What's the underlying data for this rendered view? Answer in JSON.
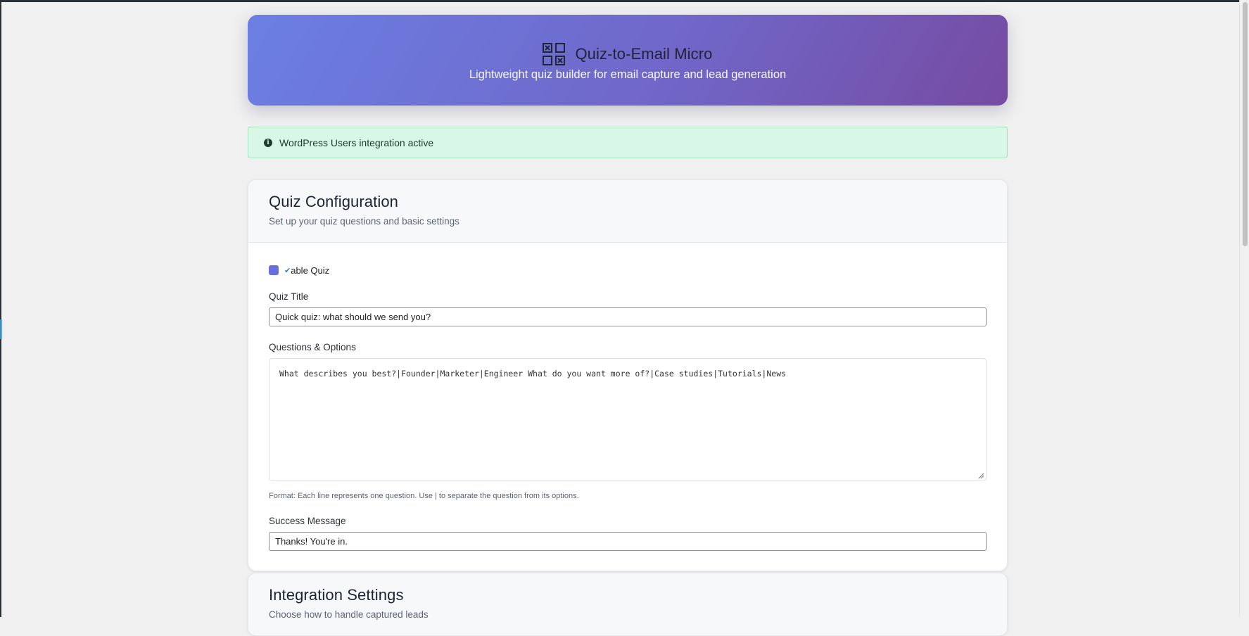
{
  "app": {
    "title": "Quiz-to-Email Micro",
    "subtitle": "Lightweight quiz builder for email capture and lead generation",
    "logo_icon": "qr-code-icon"
  },
  "alert": {
    "icon": "info-circle-icon",
    "text": "WordPress Users integration active"
  },
  "quiz_config": {
    "title": "Quiz Configuration",
    "subtitle": "Set up your quiz questions and basic settings",
    "enable_label": "able Quiz",
    "enable_checked": true,
    "quiz_title_label": "Quiz Title",
    "quiz_title_value": "Quick quiz: what should we send you?",
    "questions_label": "Questions & Options",
    "questions_value": "What describes you best?|Founder|Marketer|Engineer What do you want more of?|Case studies|Tutorials|News",
    "format_hint": "Format: Each line represents one question. Use | to separate the question from its options.",
    "success_label": "Success Message",
    "success_value": "Thanks! You're in."
  },
  "integration": {
    "title": "Integration Settings",
    "subtitle": "Choose how to handle captured leads"
  },
  "colors": {
    "accent": "#6a6fe0",
    "hero_start": "#6b7fe3",
    "hero_end": "#764ba2",
    "alert_bg": "#d9f7e6"
  }
}
